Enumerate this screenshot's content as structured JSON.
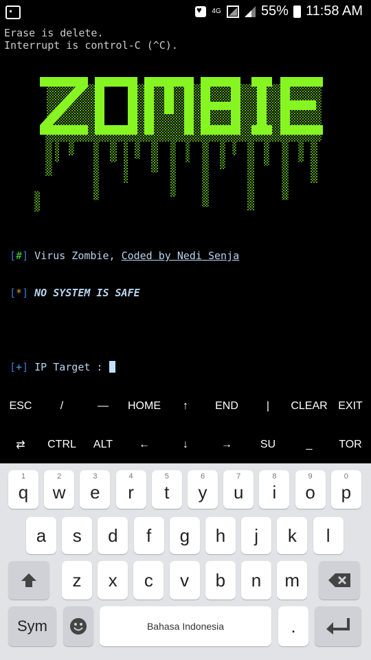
{
  "status_bar": {
    "network": "4G",
    "battery": "55%",
    "time": "11:58 AM"
  },
  "terminal": {
    "line1": "Erase is delete.",
    "line2": "Interrupt is control-C (^C)."
  },
  "logo": {
    "text": "ZOMBIE",
    "color": "#80f020"
  },
  "banner": {
    "hash_marker": "#",
    "virus_label": "Virus Zombie, ",
    "coded_by": "Coded by Nedi Senja",
    "star_marker": "*",
    "motto": "NO SYSTEM IS SAFE",
    "plus_marker": "+",
    "prompt": "IP Target : "
  },
  "extra_keys": {
    "row1": [
      "ESC",
      "/",
      "—",
      "HOME",
      "↑",
      "END",
      "|",
      "CLEAR",
      "EXIT"
    ],
    "row2": [
      "⇄",
      "CTRL",
      "ALT",
      "←",
      "↓",
      "→",
      "SU",
      "_",
      "TOR"
    ]
  },
  "keyboard": {
    "row1": [
      {
        "k": "q",
        "h": "1"
      },
      {
        "k": "w",
        "h": "2"
      },
      {
        "k": "e",
        "h": "3"
      },
      {
        "k": "r",
        "h": "4"
      },
      {
        "k": "t",
        "h": "5"
      },
      {
        "k": "y",
        "h": "6"
      },
      {
        "k": "u",
        "h": "7"
      },
      {
        "k": "i",
        "h": "8"
      },
      {
        "k": "o",
        "h": "9"
      },
      {
        "k": "p",
        "h": "0"
      }
    ],
    "row2": [
      "a",
      "s",
      "d",
      "f",
      "g",
      "h",
      "j",
      "k",
      "l"
    ],
    "row3": [
      "z",
      "x",
      "c",
      "v",
      "b",
      "n",
      "m"
    ],
    "sym": "Sym",
    "space": "Bahasa Indonesia",
    "period": "."
  }
}
